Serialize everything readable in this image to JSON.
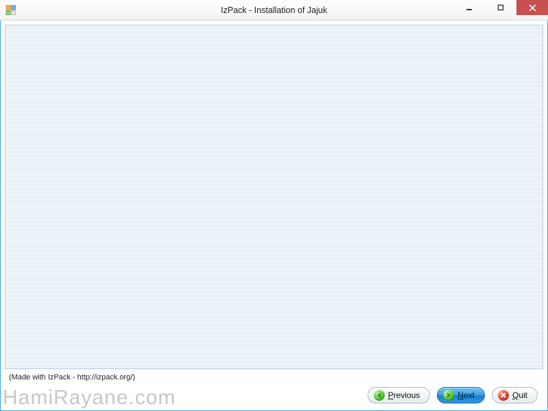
{
  "window": {
    "title": "IzPack - Installation of Jajuk"
  },
  "footer": {
    "made_with": "(Made with IzPack - http://izpack.org/)"
  },
  "buttons": {
    "previous": {
      "label": "Previous",
      "accel_index": 0
    },
    "next": {
      "label": "Next",
      "accel_index": 0
    },
    "quit": {
      "label": "Quit",
      "accel_index": 0
    }
  },
  "watermark": "HamiRayane.com"
}
